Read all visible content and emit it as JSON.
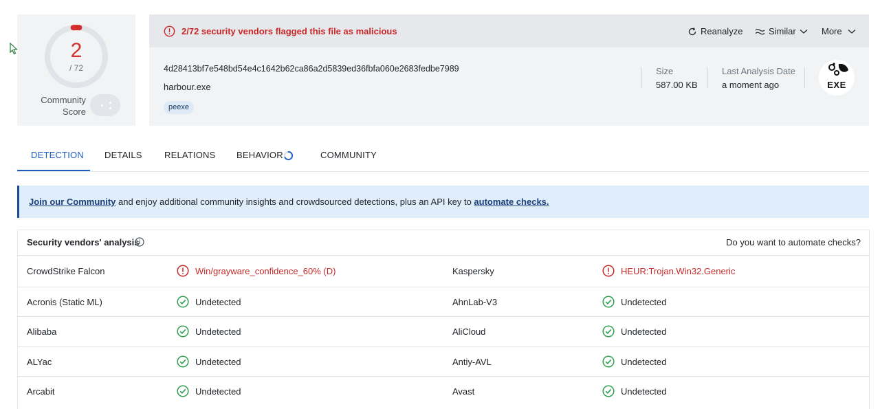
{
  "score": {
    "detections": "2",
    "total": "/ 72",
    "community_label_line1": "Community",
    "community_label_line2": "Score"
  },
  "alert": {
    "text": "2/72 security vendors flagged this file as malicious"
  },
  "actions": {
    "reanalyze": "Reanalyze",
    "similar": "Similar",
    "more": "More"
  },
  "file": {
    "hash": "4d28413bf7e548bd54e4c1642b62ca86a2d5839ed36fbfa060e2683fedbe7989",
    "name": "harbour.exe",
    "tag": "peexe",
    "size_label": "Size",
    "size_value": "587.00 KB",
    "date_label": "Last Analysis Date",
    "date_value": "a moment ago",
    "type_badge": "EXE"
  },
  "tabs": [
    {
      "label": "DETECTION"
    },
    {
      "label": "DETAILS"
    },
    {
      "label": "RELATIONS"
    },
    {
      "label": "BEHAVIOR"
    },
    {
      "label": "COMMUNITY"
    }
  ],
  "banner": {
    "link1": "Join our Community",
    "middle": " and enjoy additional community insights and crowdsourced detections, plus an API key to ",
    "link2": "automate checks."
  },
  "vendors": {
    "title": "Security vendors' analysis",
    "automate_question": "Do you want to automate checks?",
    "rows": [
      {
        "left": {
          "vendor": "CrowdStrike Falcon",
          "result": "Win/grayware_confidence_60% (D)",
          "status": "malicious"
        },
        "right": {
          "vendor": "Kaspersky",
          "result": "HEUR:Trojan.Win32.Generic",
          "status": "malicious"
        }
      },
      {
        "left": {
          "vendor": "Acronis (Static ML)",
          "result": "Undetected",
          "status": "undetected"
        },
        "right": {
          "vendor": "AhnLab-V3",
          "result": "Undetected",
          "status": "undetected"
        }
      },
      {
        "left": {
          "vendor": "Alibaba",
          "result": "Undetected",
          "status": "undetected"
        },
        "right": {
          "vendor": "AliCloud",
          "result": "Undetected",
          "status": "undetected"
        }
      },
      {
        "left": {
          "vendor": "ALYac",
          "result": "Undetected",
          "status": "undetected"
        },
        "right": {
          "vendor": "Antiy-AVL",
          "result": "Undetected",
          "status": "undetected"
        }
      },
      {
        "left": {
          "vendor": "Arcabit",
          "result": "Undetected",
          "status": "undetected"
        },
        "right": {
          "vendor": "Avast",
          "result": "Undetected",
          "status": "undetected"
        }
      }
    ]
  },
  "colors": {
    "malicious": "#c62828",
    "undetected": "#2e9e4f",
    "accent": "#1c5dbf"
  }
}
